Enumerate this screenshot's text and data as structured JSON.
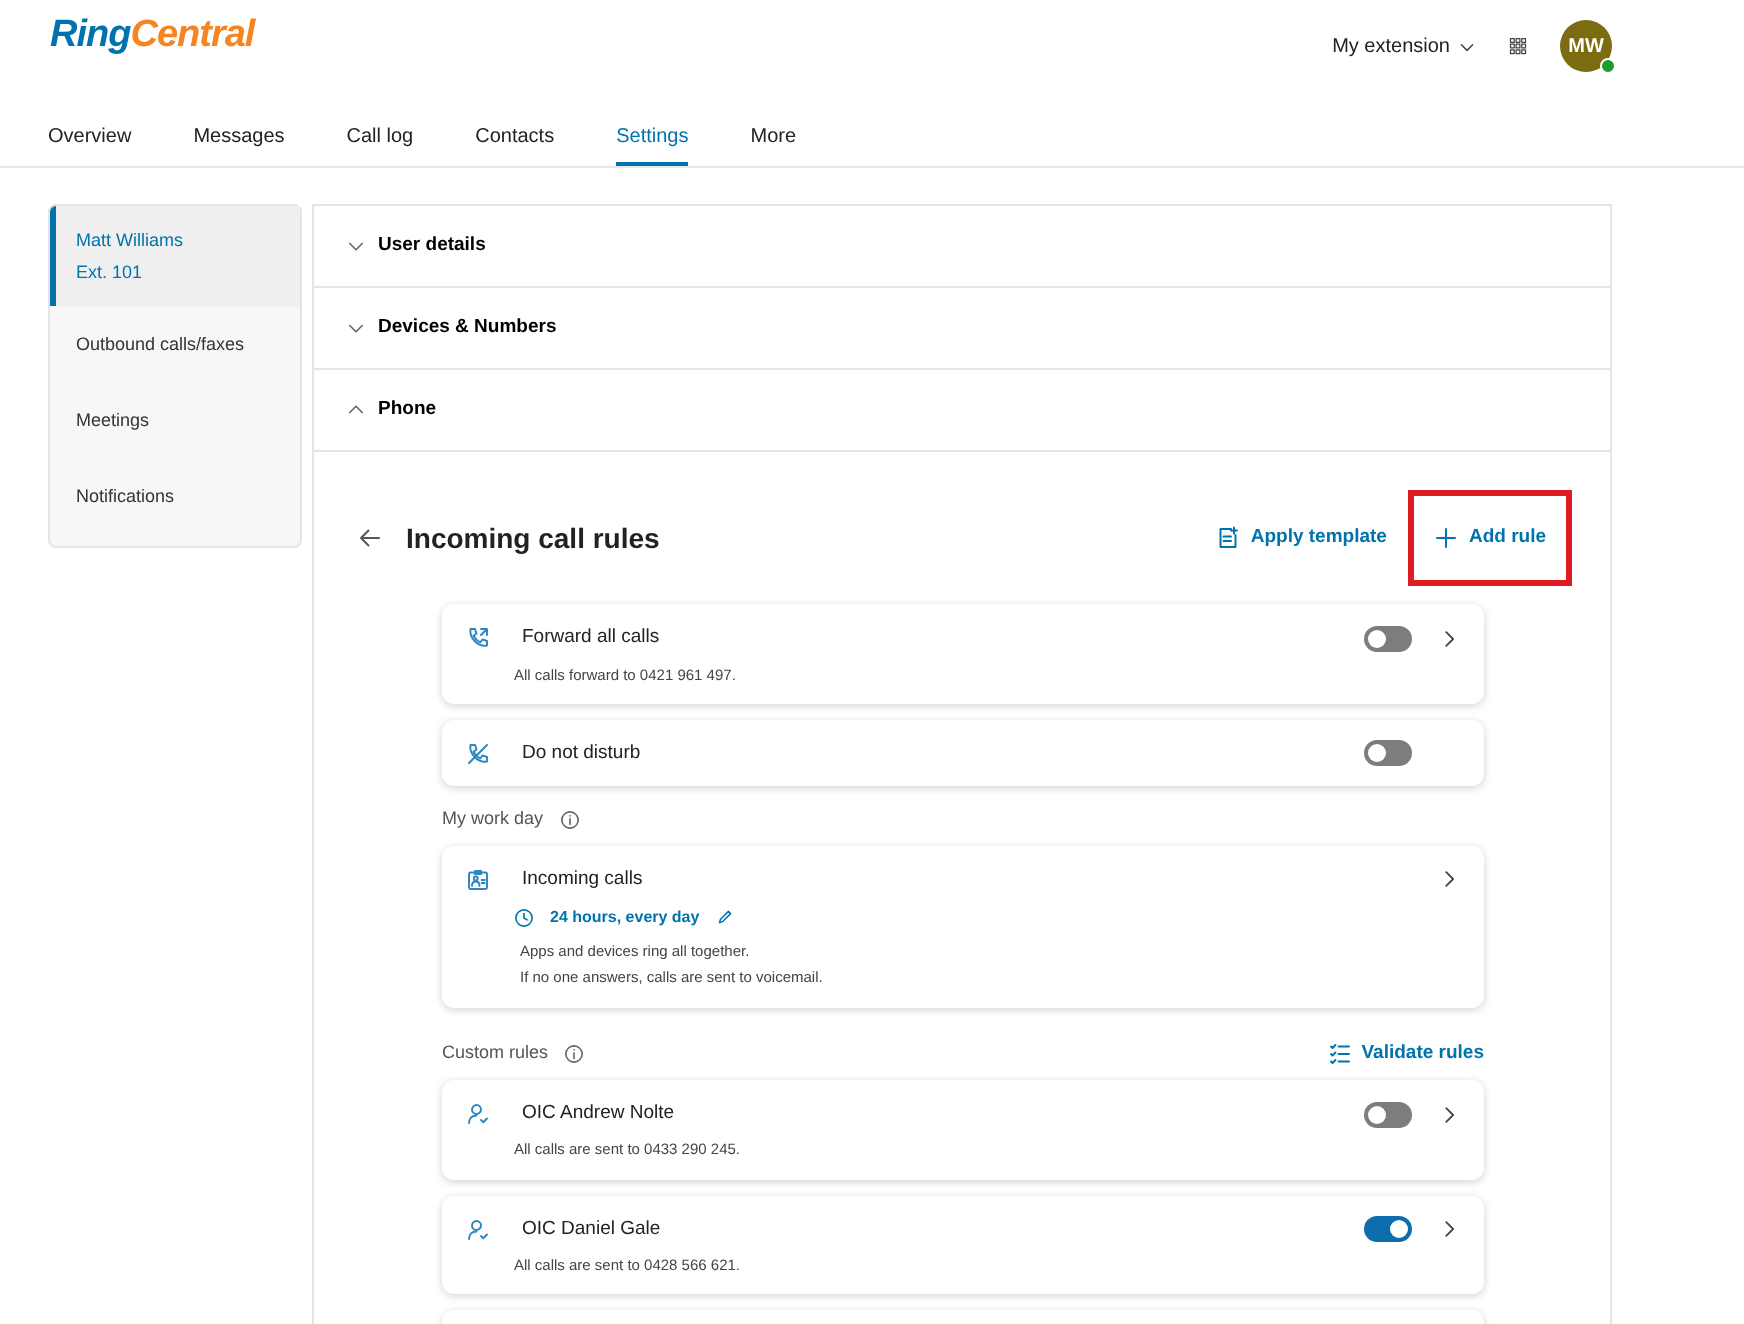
{
  "header": {
    "logo": {
      "part_1": "Ring",
      "part_2": "Central"
    },
    "extension_menu": "My extension",
    "avatar": {
      "initials": "MW",
      "online": true
    }
  },
  "nav_tabs": [
    {
      "label": "Overview",
      "selected": false
    },
    {
      "label": "Messages",
      "selected": false
    },
    {
      "label": "Call log",
      "selected": false
    },
    {
      "label": "Contacts",
      "selected": false
    },
    {
      "label": "Settings",
      "selected": true
    },
    {
      "label": "More",
      "selected": false
    }
  ],
  "sidebar": {
    "items": [
      {
        "lines": [
          "Matt Williams",
          "Ext. 101"
        ],
        "selected": true
      },
      {
        "lines": [
          "Outbound calls/faxes"
        ],
        "selected": false
      },
      {
        "lines": [
          "Meetings"
        ],
        "selected": false
      },
      {
        "lines": [
          "Notifications"
        ],
        "selected": false
      }
    ]
  },
  "sections": [
    {
      "title": "User details",
      "expanded": false
    },
    {
      "title": "Devices & Numbers",
      "expanded": false
    },
    {
      "title": "Phone",
      "expanded": true
    }
  ],
  "incoming_call_rules": {
    "title": "Incoming call rules",
    "actions": [
      {
        "label": "Apply template",
        "kind": "template",
        "highlighted": false
      },
      {
        "label": "Add rule",
        "kind": "add",
        "highlighted": true
      }
    ],
    "rules": [
      {
        "kind": "forward",
        "title": "Forward all calls",
        "detail": "All calls forward to 0421 961 497.",
        "on": false,
        "has_details": true
      },
      {
        "kind": "dnd",
        "title": "Do not disturb",
        "on": false,
        "has_details": false
      }
    ],
    "work_day": {
      "label": "My work day",
      "card": {
        "title": "Incoming calls",
        "schedule": "24 hours, every day",
        "lines": [
          "Apps and devices ring all together.",
          "If no one answers, calls are sent to voicemail."
        ]
      }
    },
    "custom_rules": {
      "label": "Custom rules",
      "validate": "Validate rules",
      "rules": [
        {
          "kind": "person",
          "title": "OIC Andrew Nolte",
          "detail": "All calls are sent to 0433 290 245.",
          "on": false,
          "has_details": true
        },
        {
          "kind": "person",
          "title": "OIC Daniel Gale",
          "detail": "All calls are sent to 0428 566 621.",
          "on": true,
          "has_details": true
        },
        {
          "kind": "stub"
        }
      ]
    }
  }
}
